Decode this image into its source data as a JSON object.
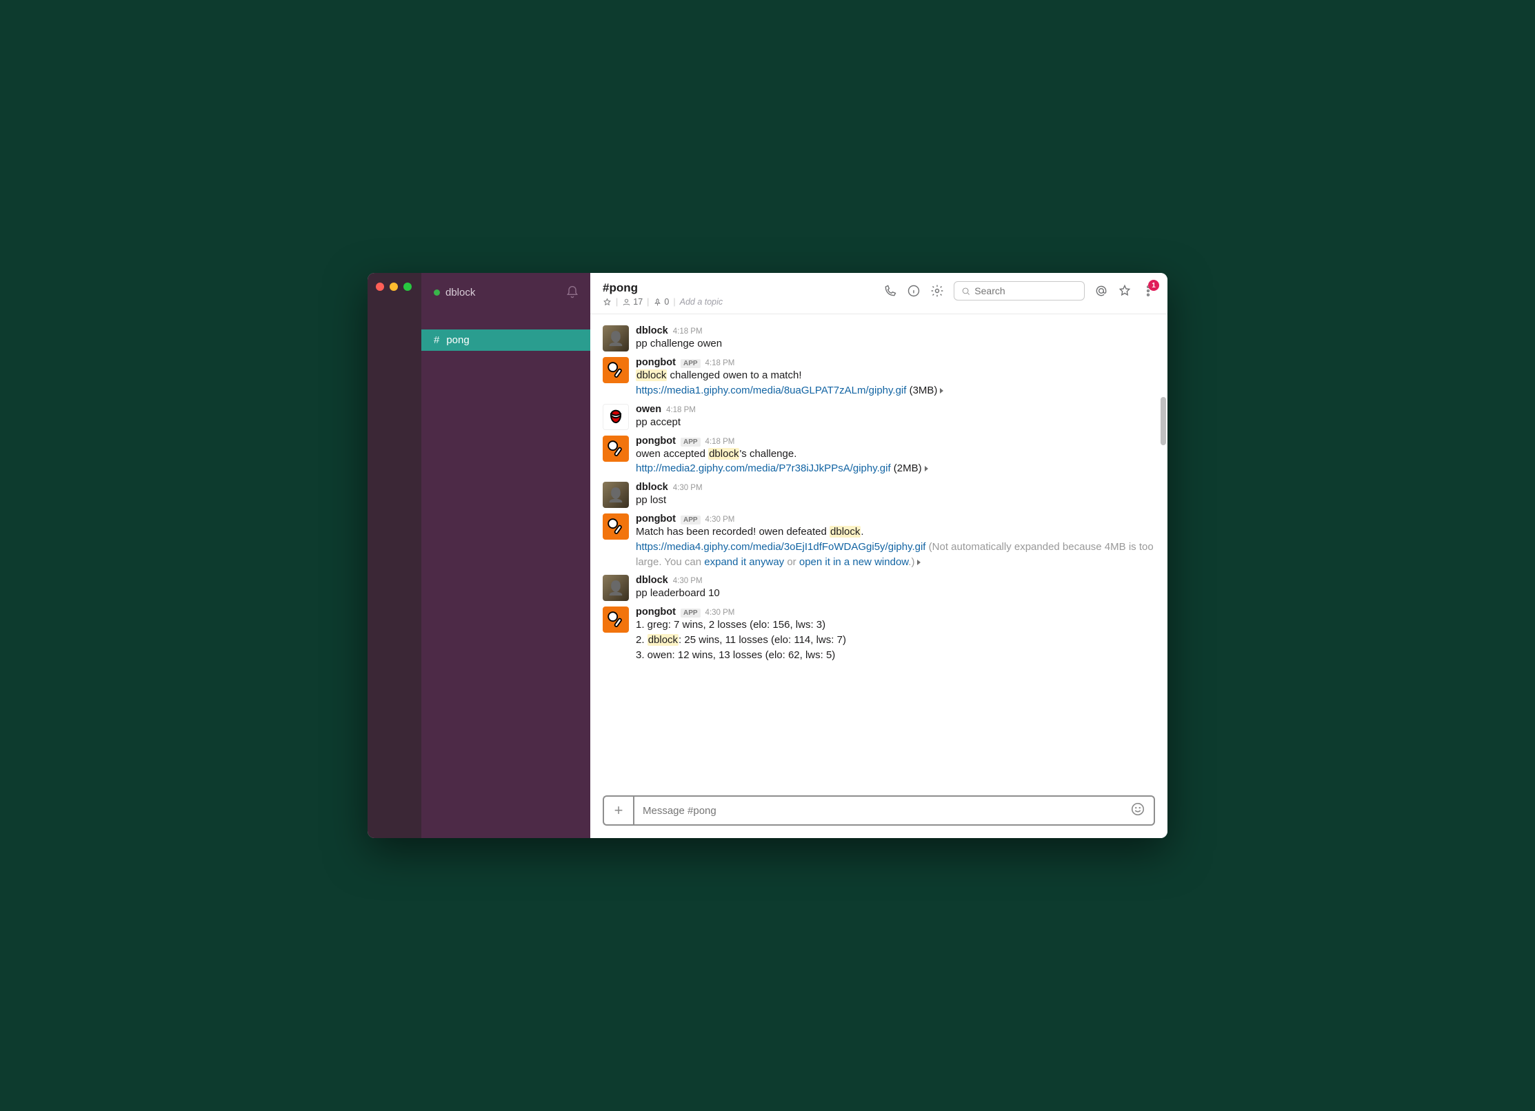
{
  "workspace": {
    "name": "dblock"
  },
  "sidebar": {
    "channels": [
      {
        "prefix": "#",
        "name": "pong",
        "active": true
      }
    ]
  },
  "header": {
    "channel": "#pong",
    "members": "17",
    "pins": "0",
    "topic_placeholder": "Add a topic",
    "search_placeholder": "Search",
    "notification_count": "1"
  },
  "messages": [
    {
      "user": "dblock",
      "avatar": "user",
      "time": "4:18 PM",
      "lines": [
        {
          "parts": [
            {
              "t": "pp challenge owen"
            }
          ]
        }
      ]
    },
    {
      "user": "pongbot",
      "avatar": "bot",
      "app": "APP",
      "time": "4:18 PM",
      "lines": [
        {
          "parts": [
            {
              "t": "dblock",
              "hl": true
            },
            {
              "t": " challenged owen to a match!"
            }
          ]
        },
        {
          "parts": [
            {
              "t": "https://media1.giphy.com/media/8uaGLPAT7zALm/giphy.gif",
              "link": true
            },
            {
              "t": " (3MB)"
            },
            {
              "caret": true
            }
          ]
        }
      ]
    },
    {
      "user": "owen",
      "avatar": "owen",
      "time": "4:18 PM",
      "lines": [
        {
          "parts": [
            {
              "t": "pp accept"
            }
          ]
        }
      ]
    },
    {
      "user": "pongbot",
      "avatar": "bot",
      "app": "APP",
      "time": "4:18 PM",
      "lines": [
        {
          "parts": [
            {
              "t": "owen accepted "
            },
            {
              "t": "dblock",
              "hl": true
            },
            {
              "t": "'s challenge."
            }
          ]
        },
        {
          "parts": [
            {
              "t": "http://media2.giphy.com/media/P7r38iJJkPPsA/giphy.gif",
              "link": true
            },
            {
              "t": " (2MB)"
            },
            {
              "caret": true
            }
          ]
        }
      ]
    },
    {
      "user": "dblock",
      "avatar": "user",
      "time": "4:30 PM",
      "lines": [
        {
          "parts": [
            {
              "t": "pp lost"
            }
          ]
        }
      ]
    },
    {
      "user": "pongbot",
      "avatar": "bot",
      "app": "APP",
      "time": "4:30 PM",
      "lines": [
        {
          "parts": [
            {
              "t": "Match has been recorded! owen defeated "
            },
            {
              "t": "dblock",
              "hl": true
            },
            {
              "t": "."
            }
          ]
        },
        {
          "parts": [
            {
              "t": "https://media4.giphy.com/media/3oEjI1dfFoWDAGgi5y/giphy.gif",
              "link": true
            },
            {
              "t": " (Not automatically expanded because 4MB is too large. You can ",
              "gray": true
            },
            {
              "t": "expand it anyway",
              "link": true
            },
            {
              "t": " or ",
              "gray": true
            },
            {
              "t": "open it in a new window",
              "link": true
            },
            {
              "t": ".)",
              "gray": true
            },
            {
              "caret": true
            }
          ]
        }
      ]
    },
    {
      "user": "dblock",
      "avatar": "user",
      "time": "4:30 PM",
      "lines": [
        {
          "parts": [
            {
              "t": "pp leaderboard 10"
            }
          ]
        }
      ]
    },
    {
      "user": "pongbot",
      "avatar": "bot",
      "app": "APP",
      "time": "4:30 PM",
      "lines": [
        {
          "parts": [
            {
              "t": "1. greg: 7 wins, 2 losses (elo: 156, lws: 3)"
            }
          ]
        },
        {
          "parts": [
            {
              "t": "2. "
            },
            {
              "t": "dblock",
              "hl": true
            },
            {
              "t": ": 25 wins, 11 losses (elo: 114, lws: 7)"
            }
          ]
        },
        {
          "parts": [
            {
              "t": "3. owen: 12 wins, 13 losses (elo: 62, lws: 5)"
            }
          ]
        }
      ]
    }
  ],
  "composer": {
    "placeholder": "Message #pong"
  }
}
